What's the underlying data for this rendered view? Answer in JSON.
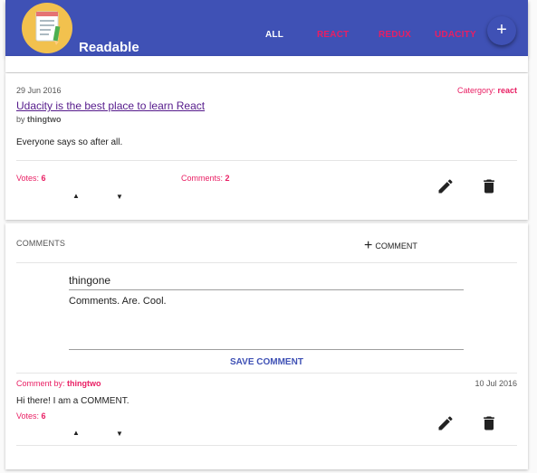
{
  "app": {
    "title": "Readable"
  },
  "nav": {
    "tabs": [
      {
        "label": "ALL",
        "active": true
      },
      {
        "label": "REACT",
        "active": false
      },
      {
        "label": "REDUX",
        "active": false
      },
      {
        "label": "UDACITY",
        "active": false
      }
    ],
    "add_icon": "+"
  },
  "post": {
    "date": "29 Jun 2016",
    "category_label": "Catergory: ",
    "category": "react",
    "title": "Udacity is the best place to learn React",
    "author_prefix": "by ",
    "author": "thingtwo",
    "body": "Everyone says so after all.",
    "votes_label": "Votes: ",
    "votes": "6",
    "comments_label": "Comments: ",
    "comments_count": "2"
  },
  "comments_section": {
    "header": "COMMENTS",
    "add_comment_label": "COMMENT",
    "form": {
      "author_value": "thingone",
      "body_value": "Comments. Are. Cool.",
      "save_label": "SAVE COMMENT"
    },
    "items": [
      {
        "by_label": "Comment by: ",
        "author": "thingtwo",
        "date": "10 Jul 2016",
        "body": "Hi there! I am a COMMENT.",
        "votes_label": "Votes: ",
        "votes": "6"
      }
    ]
  },
  "colors": {
    "primary": "#3f51b5",
    "accent": "#e91e63",
    "logo_bg": "#f2c14e"
  },
  "icons": [
    "edit-icon",
    "delete-icon",
    "upvote-icon",
    "downvote-icon",
    "add-icon"
  ]
}
